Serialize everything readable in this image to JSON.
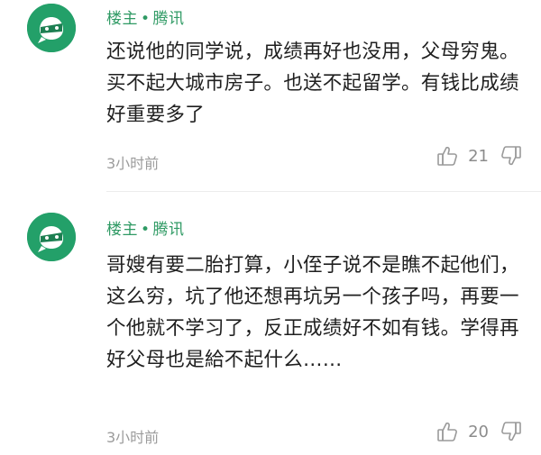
{
  "comments": [
    {
      "author": "楼主",
      "separator": "•",
      "source": "腾讯",
      "content": "还说他的同学说，成绩再好也没用，父母穷鬼。买不起大城市房子。也送不起留学。有钱比成绩好重要多了",
      "time": "3小时前",
      "likes": "21",
      "avatar_icon": "mask-avatar-icon",
      "like_icon": "thumbs-up-icon",
      "dislike_icon": "thumbs-down-icon"
    },
    {
      "author": "楼主",
      "separator": "•",
      "source": "腾讯",
      "content": "哥嫂有要二胎打算，小侄子说不是瞧不起他们，这么穷，坑了他还想再坑另一个孩子吗，再要一个他就不学习了，反正成绩好不如有钱。学得再好父母也是給不起什么……",
      "time": "3小时前",
      "likes": "20",
      "avatar_icon": "mask-avatar-icon",
      "like_icon": "thumbs-up-icon",
      "dislike_icon": "thumbs-down-icon"
    }
  ],
  "colors": {
    "accent": "#2f9a64",
    "avatar_bg": "#23a069",
    "muted": "#9b9b9b"
  }
}
